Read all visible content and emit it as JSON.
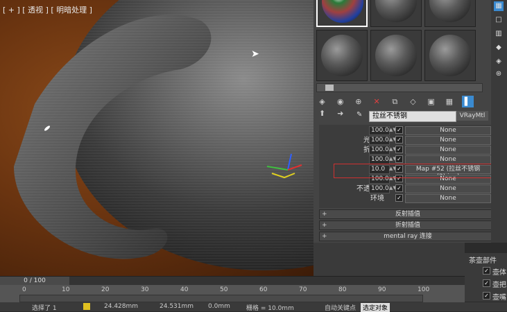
{
  "viewport": {
    "label": "[ + ] [ 透视 ] [ 明暗处理 ]"
  },
  "material": {
    "name": "拉丝不锈钢",
    "type": "VRayMtl"
  },
  "maps": [
    {
      "label": "折射",
      "value": "100.0",
      "checked": true,
      "map": "None"
    },
    {
      "label": "光泽度",
      "value": "100.0",
      "checked": true,
      "map": "None"
    },
    {
      "label": "折射率",
      "value": "100.0",
      "checked": true,
      "map": "None"
    },
    {
      "label": "透明",
      "value": "100.0",
      "checked": true,
      "map": "None"
    },
    {
      "label": "凹凸",
      "value": "10.0",
      "checked": true,
      "map": "Map #52 (拉丝不锈钢 (2).jpg)"
    },
    {
      "label": "置换",
      "value": "100.0",
      "checked": true,
      "map": "None"
    },
    {
      "label": "不透明度",
      "value": "100.0",
      "checked": true,
      "map": "None"
    },
    {
      "label": "环境",
      "value": "",
      "checked": true,
      "map": "None"
    }
  ],
  "rollouts": [
    "反射插值",
    "折射插值",
    "mental ray 连接"
  ],
  "teapot_parts": {
    "title": "茶壶部件",
    "items": [
      {
        "label": "壶体",
        "checked": true
      },
      {
        "label": "壶把",
        "checked": true
      },
      {
        "label": "壶嘴",
        "checked": true
      }
    ]
  },
  "timeline": {
    "frame": "0 / 100",
    "ticks": [
      "0",
      "10",
      "20",
      "30",
      "40",
      "50",
      "60",
      "70",
      "80",
      "90",
      "100"
    ]
  },
  "status": {
    "selection": "选择了 1",
    "x": "24.428mm",
    "y": "24.531mm",
    "z": "0.0mm",
    "grid": "栅格 = 10.0mm",
    "auto_key": "自动关键点",
    "set_key_mode": "选定对象"
  }
}
